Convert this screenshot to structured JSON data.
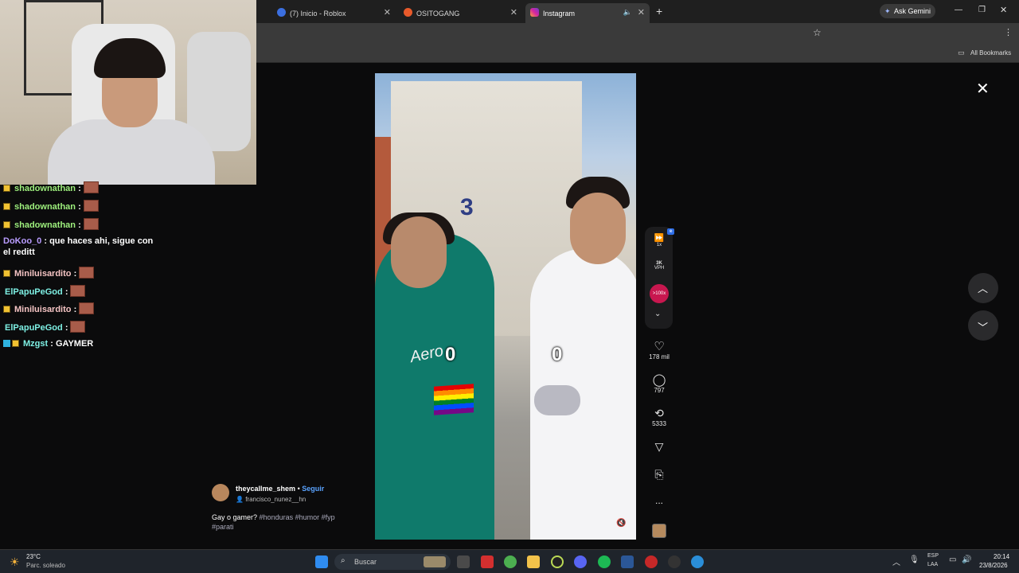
{
  "browser": {
    "tabs": [
      {
        "label": "(7) Inicio - Roblox",
        "color": "#3b6fe0"
      },
      {
        "label": "OSITOGANG",
        "color": "#e85a2b"
      },
      {
        "label": "Instagram",
        "color": "#d6249f"
      }
    ],
    "ask_gemini": "Ask Gemini",
    "all_bookmarks": "All Bookmarks"
  },
  "chat": {
    "lines": [
      {
        "user": "shadownathan",
        "msg": ":",
        "badge": true,
        "emote": true,
        "color": "#9ef07d"
      },
      {
        "user": "shadownathan",
        "msg": ":",
        "badge": true,
        "emote": true,
        "color": "#9ef07d"
      },
      {
        "user": "shadownathan",
        "msg": ":",
        "badge": true,
        "emote": true,
        "color": "#9ef07d"
      },
      {
        "user": "DoKoo_0",
        "msg": ": que haces ahi, sigue con el reditt",
        "badge": false,
        "emote": false,
        "color": "#b99cff"
      },
      {
        "user": "Miniluisardito",
        "msg": ":",
        "badge": true,
        "emote": true,
        "color": "#f5c4c4"
      },
      {
        "user": "ElPapuPeGod",
        "msg": ":",
        "badge": false,
        "emote": true,
        "color": "#7ef0e4"
      },
      {
        "user": "Miniluisardito",
        "msg": ":",
        "badge": true,
        "emote": true,
        "color": "#f5c4c4"
      },
      {
        "user": "ElPapuPeGod",
        "msg": ":",
        "badge": false,
        "emote": true,
        "color": "#7ef0e4"
      },
      {
        "user": "Mzgst",
        "msg": ": GAYMER",
        "badge": true,
        "emote": false,
        "color": "#7ef0e4"
      }
    ]
  },
  "video": {
    "score_left": "0",
    "score_right": "0",
    "shirt_text": "Aero",
    "building_number": "3"
  },
  "controls": {
    "speed": "1x",
    "vph": "3K",
    "vph_label": "VPH",
    "trend": ">100x",
    "likes": "178 mil",
    "comments": "797",
    "reposts": "5333",
    "more": "..."
  },
  "post": {
    "username": "theycallme_shem",
    "follow": "Seguir",
    "separator": "•",
    "collab": "francisco_nunez__hn",
    "caption": "Gay o gamer?",
    "hashtags": "#honduras #humor #fyp #parati"
  },
  "taskbar": {
    "temp": "23°C",
    "weather": "Parc. soleado",
    "search": "Buscar",
    "lang1": "ESP",
    "lang2": "LAA",
    "time": "20:14",
    "date": "23/8/2026"
  }
}
